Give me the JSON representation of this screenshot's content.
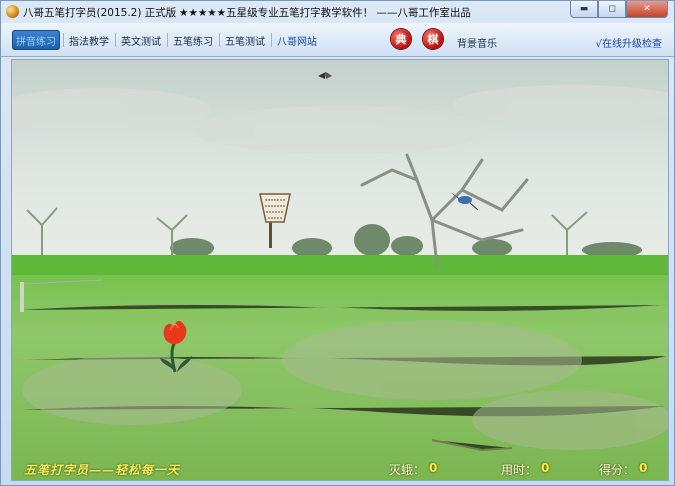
{
  "window": {
    "title": "八哥五笔打字员(2015.2) 正式版",
    "slogan": "★★★★★五星级专业五笔打字教学软件！ ——八哥工作室出品",
    "minimize_symbol": "▬",
    "maximize_symbol": "◻",
    "close_symbol": "✕"
  },
  "toolbar": {
    "items": [
      {
        "label": "拼音练习"
      },
      {
        "label": "指法教学"
      },
      {
        "label": "英文测试"
      },
      {
        "label": "五笔练习"
      },
      {
        "label": "五笔测试"
      },
      {
        "label": "八哥网站"
      }
    ],
    "dictionary_label": "典",
    "chess_label": "棋",
    "music_label": "背景音乐",
    "upgrade_label": "√在线升级检查"
  },
  "game": {
    "slogan": "五笔打字员——轻松每一天",
    "kills_label": "灭蛾：",
    "kills_value": "0",
    "time_label": "用时：",
    "time_value": "0",
    "score_label": "得分：",
    "score_value": "0"
  },
  "colors": {
    "toolbar_active": "#1d5ea8",
    "status_text": "#ffe93a",
    "tulip": "#e8371a"
  },
  "icons": [
    "app-icon",
    "minimize-icon",
    "maximize-icon",
    "close-icon"
  ]
}
